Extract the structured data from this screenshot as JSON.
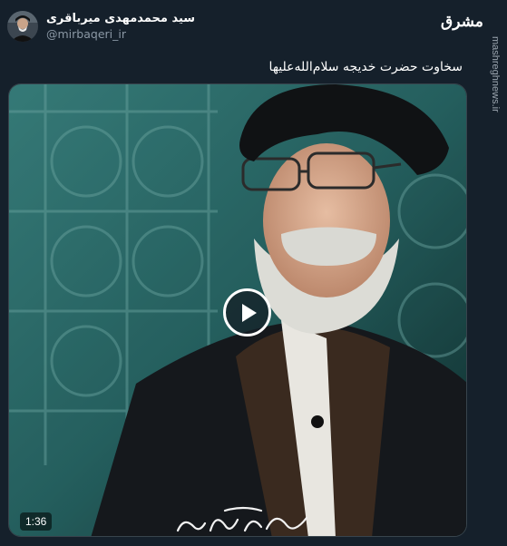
{
  "author": {
    "display_name": "سید محمدمهدی میرباقری",
    "handle": "@mirbaqeri_ir"
  },
  "watermark": {
    "logo_text": "مشرق",
    "side_url": "mashreghnews.ir"
  },
  "tweet": {
    "text": "سخاوت حضرت خدیجه سلام‌الله‌علیها"
  },
  "video": {
    "duration": "1:36",
    "play_icon": "play-icon"
  },
  "colors": {
    "background": "#15202b",
    "secondary_text": "#8b98a5",
    "border": "#38444d"
  }
}
